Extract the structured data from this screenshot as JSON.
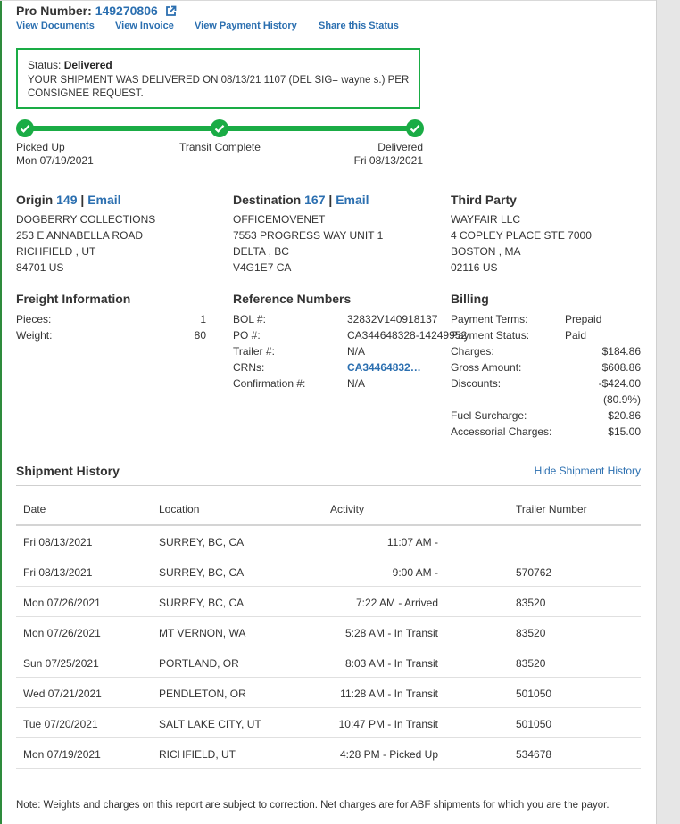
{
  "header": {
    "pro_label": "Pro Number:",
    "pro_number": "149270806",
    "links": [
      "View Documents",
      "View Invoice",
      "View Payment History",
      "Share this Status"
    ]
  },
  "status": {
    "label": "Status:",
    "value": "Delivered",
    "message": "YOUR SHIPMENT WAS DELIVERED ON 08/13/21 1107 (DEL SIG= wayne s.) PER CONSIGNEE REQUEST."
  },
  "progress": {
    "milestones": [
      {
        "label": "Picked Up",
        "date": "Mon 07/19/2021"
      },
      {
        "label": "Transit Complete",
        "date": ""
      },
      {
        "label": "Delivered",
        "date": "Fri 08/13/2021"
      }
    ],
    "completed_fraction": 1.0
  },
  "origin": {
    "title": "Origin",
    "code": "149",
    "email": "Email",
    "lines": [
      "DOGBERRY COLLECTIONS",
      "253 E ANNABELLA ROAD",
      "RICHFIELD , UT",
      "84701 US"
    ]
  },
  "destination": {
    "title": "Destination",
    "code": "167",
    "email": "Email",
    "lines": [
      "OFFICEMOVENET",
      "7553 PROGRESS WAY UNIT 1",
      "DELTA , BC",
      "V4G1E7 CA"
    ]
  },
  "third_party": {
    "title": "Third Party",
    "lines": [
      "WAYFAIR LLC",
      "4 COPLEY PLACE STE 7000",
      "BOSTON , MA",
      "02116 US"
    ]
  },
  "freight": {
    "title": "Freight Information",
    "rows": [
      {
        "label": "Pieces:",
        "value": "1"
      },
      {
        "label": "Weight:",
        "value": "80"
      }
    ]
  },
  "reference": {
    "title": "Reference Numbers",
    "rows": [
      {
        "label": "BOL #:",
        "value": "32832V140918137"
      },
      {
        "label": "PO #:",
        "value": "CA344648328-14249952"
      },
      {
        "label": "Trailer #:",
        "value": "N/A"
      },
      {
        "label": "CRNs:",
        "value": "CA34464832…"
      },
      {
        "label": "Confirmation #:",
        "value": "N/A"
      }
    ]
  },
  "billing": {
    "title": "Billing",
    "payment_terms_label": "Payment Terms:",
    "payment_terms": "Prepaid",
    "payment_status_label": "Payment Status:",
    "payment_status": "Paid",
    "charges_label": "Charges:",
    "charges": "$184.86",
    "gross_label": "Gross Amount:",
    "gross": "$608.86",
    "discounts_label": "Discounts:",
    "discounts": "-$424.00",
    "discount_pct": "(80.9%)",
    "fuel_label": "Fuel Surcharge:",
    "fuel": "$20.86",
    "accessorial_label": "Accessorial Charges:",
    "accessorial": "$15.00"
  },
  "history": {
    "title": "Shipment History",
    "hide_link": "Hide Shipment History",
    "columns": [
      "Date",
      "Location",
      "Activity",
      "Trailer Number"
    ],
    "rows": [
      [
        "Fri 08/13/2021",
        "SURREY, BC, CA",
        "11:07 AM -",
        ""
      ],
      [
        "Fri 08/13/2021",
        "SURREY, BC, CA",
        "9:00 AM -",
        "570762"
      ],
      [
        "Mon 07/26/2021",
        "SURREY, BC, CA",
        "7:22 AM - Arrived",
        "83520"
      ],
      [
        "Mon 07/26/2021",
        "MT VERNON, WA",
        "5:28 AM - In Transit",
        "83520"
      ],
      [
        "Sun 07/25/2021",
        "PORTLAND, OR",
        "8:03 AM - In Transit",
        "83520"
      ],
      [
        "Wed 07/21/2021",
        "PENDLETON, OR",
        "11:28 AM - In Transit",
        "501050"
      ],
      [
        "Tue 07/20/2021",
        "SALT LAKE CITY, UT",
        "10:47 PM - In Transit",
        "501050"
      ],
      [
        "Mon 07/19/2021",
        "RICHFIELD, UT",
        "4:28 PM - Picked Up",
        "534678"
      ]
    ]
  },
  "footer": {
    "note": "Note: Weights and charges on this report are subject to correction. Net charges are for ABF shipments for which you are the payor."
  },
  "colors": {
    "accent_green": "#1aac45",
    "link_blue": "#2b6fb0"
  }
}
